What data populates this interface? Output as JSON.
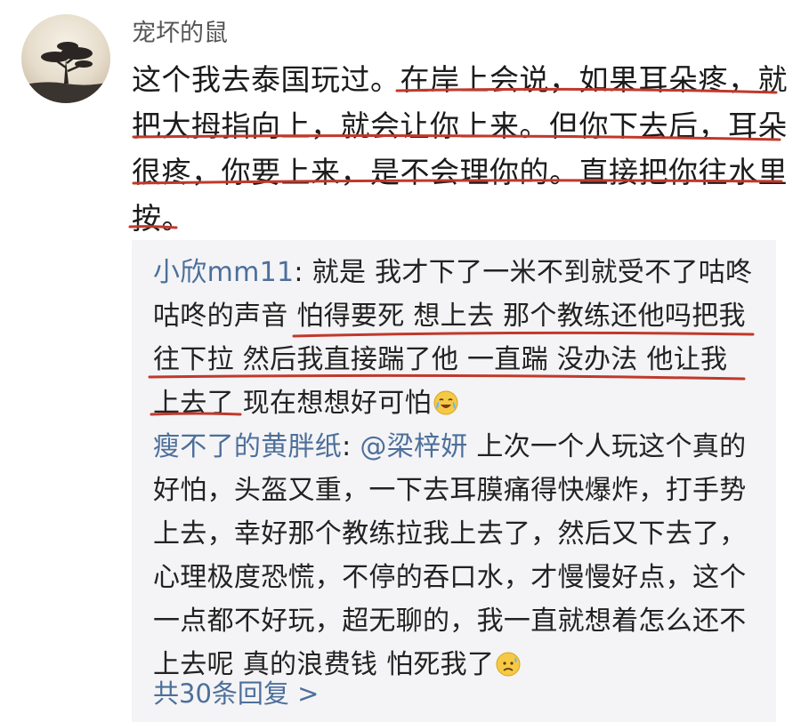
{
  "comment": {
    "username": "宠坏的鼠",
    "lines": [
      "这个我去泰国玩过。在岸上会说，如果耳朵疼，就",
      "把大拇指向上，就会让你上来。但你下去后，耳朵",
      "很疼，你要上来，是不会理你的。直接把你往水里",
      "按。"
    ]
  },
  "replies": [
    {
      "name": "小欣mm11",
      "sep": ": ",
      "lines": [
        "就是 我才下了一米不到就受不了咕咚",
        "咕咚的声音 怕得要死 想上去 那个教练还他吗把我",
        "往下拉 然后我直接踹了他 一直踹 没办法 他让我",
        "上去了 现在想想好可怕"
      ],
      "emoji": "laughing-crying-emoji"
    },
    {
      "name": "瘦不了的黄胖纸",
      "sep": ": ",
      "mention": "@梁梓妍",
      "lines": [
        " 上次一个人玩这个真的",
        "好怕，头盔又重，一下去耳膜痛得快爆炸，打手势",
        "上去，幸好那个教练拉我上去了，然后又下去了，",
        "心理极度恐慌，不停的吞口水，才慢慢好点，这个",
        "一点都不好玩，超无聊的，我一直就想着怎么还不",
        "上去呢 真的浪费钱 怕死我了"
      ],
      "emoji": "sad-sweat-emoji"
    }
  ],
  "more_replies": "共30条回复 >",
  "colors": {
    "link": "#4d6f9a",
    "underline": "#c0392b",
    "reply_bg": "#f4f4f6"
  }
}
